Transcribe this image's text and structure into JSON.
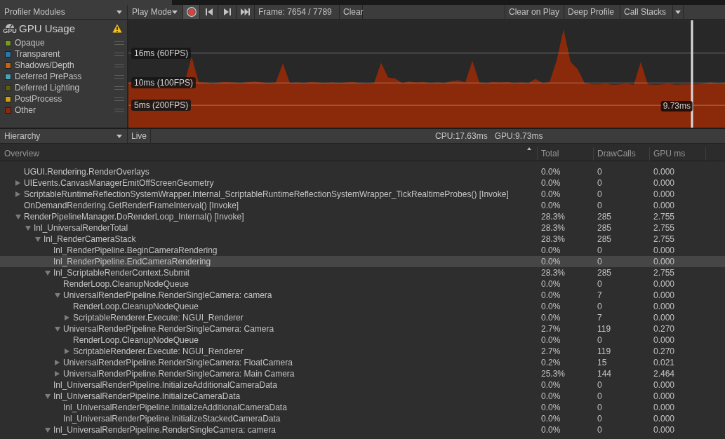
{
  "toolbar": {
    "modules_dropdown": "Profiler Modules",
    "play_mode_dropdown": "Play Mode",
    "recording": true,
    "frame": "Frame: 7654 / 7789",
    "clear": "Clear",
    "clear_on_play": {
      "label": "Clear on Play",
      "on": false
    },
    "deep_profile": {
      "label": "Deep Profile",
      "on": false
    },
    "call_stacks": {
      "label": "Call Stacks",
      "on": false
    }
  },
  "module": {
    "title": "GPU Usage",
    "icon_label": "GPU",
    "warning": true,
    "legend": [
      {
        "label": "Opaque",
        "color": "#7a9a1a"
      },
      {
        "label": "Transparent",
        "color": "#2a78a8"
      },
      {
        "label": "Shadows/Depth",
        "color": "#c4650e"
      },
      {
        "label": "Deferred PrePass",
        "color": "#48a4b4"
      },
      {
        "label": "Deferred Lighting",
        "color": "#5c5c14"
      },
      {
        "label": "PostProcess",
        "color": "#c8a010"
      },
      {
        "label": "Other",
        "color": "#8b2a0a"
      }
    ],
    "chart": {
      "reference_lines": [
        {
          "label": "16ms (60FPS)"
        },
        {
          "label": "10ms (100FPS)"
        },
        {
          "label": "5ms (200FPS)"
        }
      ],
      "selected_frame_value": "9.73ms"
    }
  },
  "details_bar": {
    "view_dropdown": "Hierarchy",
    "live": {
      "label": "Live",
      "on": false
    },
    "cpu_time": "CPU:17.63ms",
    "gpu_time": "GPU:9.73ms"
  },
  "hierarchy": {
    "columns": [
      {
        "label": "Overview",
        "sorted": true
      },
      {
        "label": "Total",
        "sorted": false
      },
      {
        "label": "DrawCalls",
        "sorted": false
      },
      {
        "label": "GPU ms",
        "sorted": false
      }
    ],
    "rows": [
      {
        "name": "UGUI.Rendering.RenderOverlays",
        "total": "0.0%",
        "draw_calls": "0",
        "gpu_ms": "0.000",
        "selected": false
      },
      {
        "name": "UIEvents.CanvasManagerEmitOffScreenGeometry",
        "total": "0.0%",
        "draw_calls": "0",
        "gpu_ms": "0.000",
        "expanded": false,
        "selected": false
      },
      {
        "name": "ScriptableRuntimeReflectionSystemWrapper.Internal_ScriptableRuntimeReflectionSystemWrapper_TickRealtimeProbes() [Invoke]",
        "total": "0.0%",
        "draw_calls": "0",
        "gpu_ms": "0.000",
        "expanded": false,
        "selected": false
      },
      {
        "name": "OnDemandRendering.GetRenderFrameInterval() [Invoke]",
        "total": "0.0%",
        "draw_calls": "0",
        "gpu_ms": "0.000",
        "selected": false
      },
      {
        "name": "RenderPipelineManager.DoRenderLoop_Internal() [Invoke]",
        "total": "28.3%",
        "draw_calls": "285",
        "gpu_ms": "2.755",
        "expanded": true,
        "selected": false,
        "children": [
          {
            "name": "Inl_UniversalRenderTotal",
            "total": "28.3%",
            "draw_calls": "285",
            "gpu_ms": "2.755",
            "expanded": true,
            "selected": false,
            "children": [
              {
                "name": "Inl_RenderCameraStack",
                "total": "28.3%",
                "draw_calls": "285",
                "gpu_ms": "2.755",
                "expanded": true,
                "selected": false,
                "children": [
                  {
                    "name": "Inl_RenderPipeline.BeginCameraRendering",
                    "total": "0.0%",
                    "draw_calls": "0",
                    "gpu_ms": "0.000",
                    "selected": false
                  },
                  {
                    "name": "Inl_RenderPipeline.EndCameraRendering",
                    "total": "0.0%",
                    "draw_calls": "0",
                    "gpu_ms": "0.000",
                    "selected": true
                  },
                  {
                    "name": "Inl_ScriptableRenderContext.Submit",
                    "total": "28.3%",
                    "draw_calls": "285",
                    "gpu_ms": "2.755",
                    "expanded": true,
                    "selected": false,
                    "children": [
                      {
                        "name": "RenderLoop.CleanupNodeQueue",
                        "total": "0.0%",
                        "draw_calls": "0",
                        "gpu_ms": "0.000",
                        "selected": false
                      },
                      {
                        "name": "UniversalRenderPipeline.RenderSingleCamera: camera",
                        "total": "0.0%",
                        "draw_calls": "7",
                        "gpu_ms": "0.000",
                        "expanded": true,
                        "selected": false,
                        "children": [
                          {
                            "name": "RenderLoop.CleanupNodeQueue",
                            "total": "0.0%",
                            "draw_calls": "0",
                            "gpu_ms": "0.000",
                            "selected": false
                          },
                          {
                            "name": "ScriptableRenderer.Execute: NGUI_Renderer",
                            "total": "0.0%",
                            "draw_calls": "7",
                            "gpu_ms": "0.000",
                            "expanded": false,
                            "selected": false
                          }
                        ]
                      },
                      {
                        "name": "UniversalRenderPipeline.RenderSingleCamera: Camera",
                        "total": "2.7%",
                        "draw_calls": "119",
                        "gpu_ms": "0.270",
                        "expanded": true,
                        "selected": false,
                        "children": [
                          {
                            "name": "RenderLoop.CleanupNodeQueue",
                            "total": "0.0%",
                            "draw_calls": "0",
                            "gpu_ms": "0.000",
                            "selected": false
                          },
                          {
                            "name": "ScriptableRenderer.Execute: NGUI_Renderer",
                            "total": "2.7%",
                            "draw_calls": "119",
                            "gpu_ms": "0.270",
                            "expanded": false,
                            "selected": false
                          }
                        ]
                      },
                      {
                        "name": "UniversalRenderPipeline.RenderSingleCamera: FloatCamera",
                        "total": "0.2%",
                        "draw_calls": "15",
                        "gpu_ms": "0.021",
                        "expanded": false,
                        "selected": false
                      },
                      {
                        "name": "UniversalRenderPipeline.RenderSingleCamera: Main Camera",
                        "total": "25.3%",
                        "draw_calls": "144",
                        "gpu_ms": "2.464",
                        "expanded": false,
                        "selected": false
                      }
                    ]
                  },
                  {
                    "name": "Inl_UniversalRenderPipeline.InitializeAdditionalCameraData",
                    "total": "0.0%",
                    "draw_calls": "0",
                    "gpu_ms": "0.000",
                    "selected": false
                  },
                  {
                    "name": "Inl_UniversalRenderPipeline.InitializeCameraData",
                    "total": "0.0%",
                    "draw_calls": "0",
                    "gpu_ms": "0.000",
                    "expanded": true,
                    "selected": false,
                    "children": [
                      {
                        "name": "Inl_UniversalRenderPipeline.InitializeAdditionalCameraData",
                        "total": "0.0%",
                        "draw_calls": "0",
                        "gpu_ms": "0.000",
                        "selected": false
                      },
                      {
                        "name": "Inl_UniversalRenderPipeline.InitializeStackedCameraData",
                        "total": "0.0%",
                        "draw_calls": "0",
                        "gpu_ms": "0.000",
                        "selected": false
                      }
                    ]
                  },
                  {
                    "name": "Inl_UniversalRenderPipeline.RenderSingleCamera: camera",
                    "total": "0.0%",
                    "draw_calls": "0",
                    "gpu_ms": "0.000",
                    "expanded": true,
                    "selected": false
                  }
                ]
              }
            ]
          }
        ]
      }
    ]
  }
}
